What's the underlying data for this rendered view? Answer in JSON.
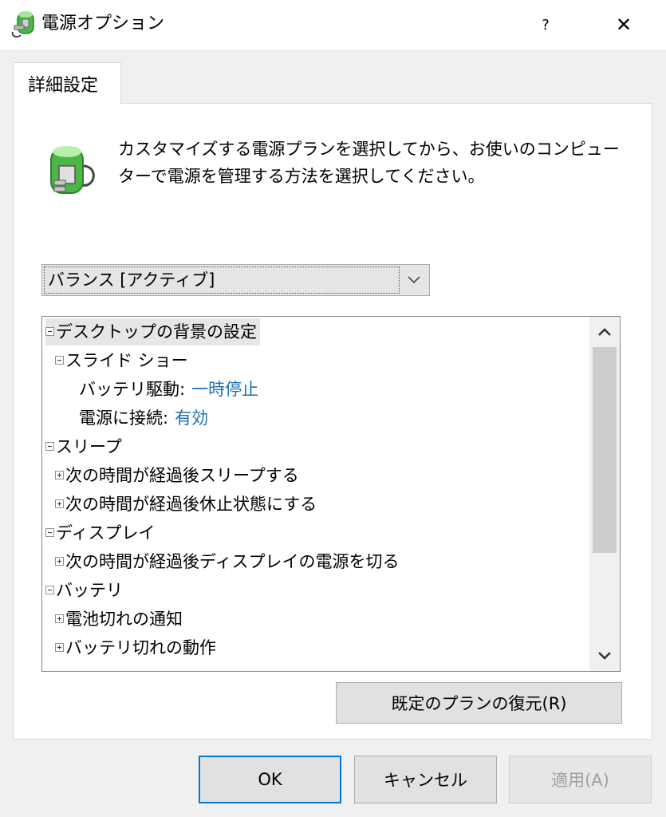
{
  "window": {
    "title": "電源オプション",
    "help_glyph": "?",
    "close_glyph": "✕"
  },
  "tab": {
    "label": "詳細設定"
  },
  "description": {
    "text": "カスタマイズする電源プランを選択してから、お使いのコンピューターで電源を管理する方法を選択してください。"
  },
  "plan_select": {
    "value": "バランス [アクティブ]"
  },
  "tree": {
    "rows": [
      {
        "label": "デスクトップの背景の設定",
        "expander": "minus"
      },
      {
        "label": "スライド ショー",
        "expander": "minus"
      },
      {
        "label": "バッテリ駆動:",
        "value": "一時停止"
      },
      {
        "label": "電源に接続:",
        "value": "有効"
      },
      {
        "label": "スリープ",
        "expander": "minus"
      },
      {
        "label": "次の時間が経過後スリープする",
        "expander": "plus"
      },
      {
        "label": "次の時間が経過後休止状態にする",
        "expander": "plus"
      },
      {
        "label": "ディスプレイ",
        "expander": "minus"
      },
      {
        "label": "次の時間が経過後ディスプレイの電源を切る",
        "expander": "plus"
      },
      {
        "label": "バッテリ",
        "expander": "minus"
      },
      {
        "label": "電池切れの通知",
        "expander": "plus"
      },
      {
        "label": "バッテリ切れの動作",
        "expander": "plus"
      }
    ]
  },
  "buttons": {
    "restore": "既定のプランの復元(R)",
    "ok": "OK",
    "cancel": "キャンセル",
    "apply": "適用(A)"
  },
  "colors": {
    "value_link": "#1a6fb6",
    "focus_border": "#0078d7"
  },
  "icons": {
    "title": "battery-plug-icon",
    "description": "battery-plug-icon",
    "combo_arrow": "chevron-down-icon",
    "scroll_up": "chevron-up-icon",
    "scroll_down": "chevron-down-icon"
  }
}
